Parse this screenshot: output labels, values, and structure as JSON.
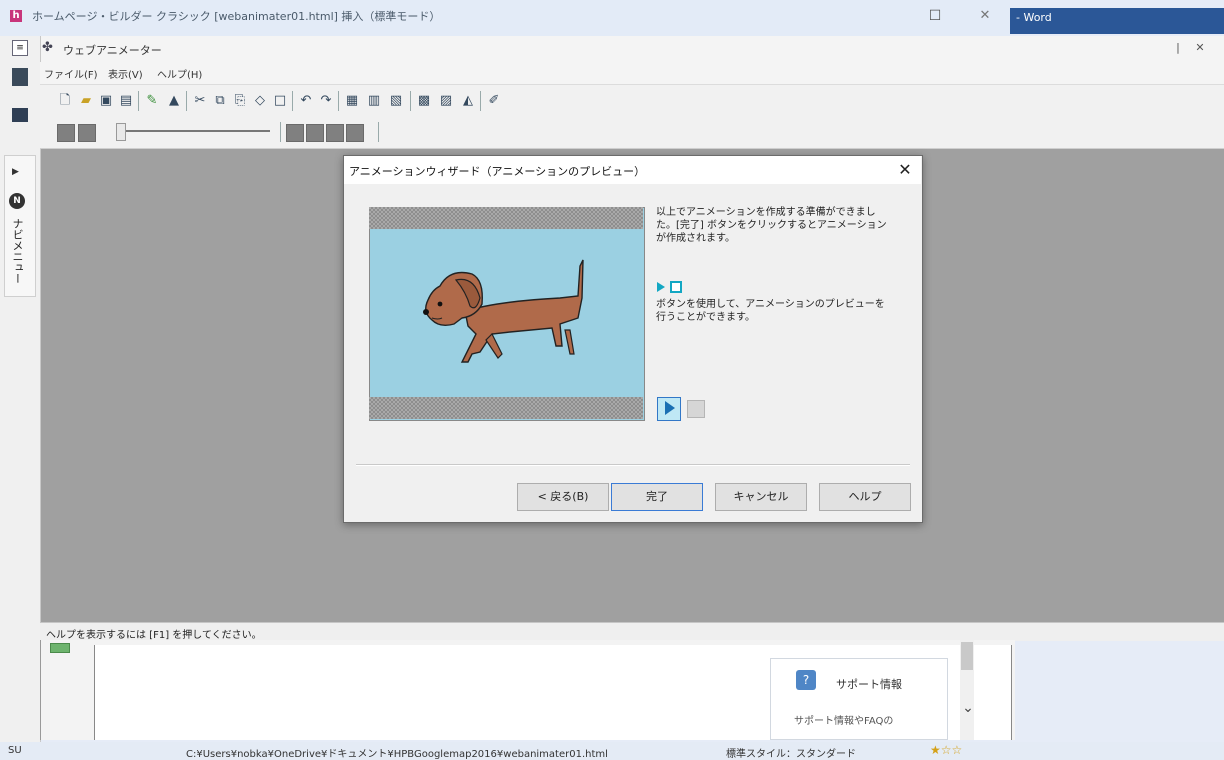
{
  "outer_window": {
    "title": "ホームページ・ビルダー クラシック [webanimater01.html] 挿入（標準モード）",
    "word_label": "- Word"
  },
  "app": {
    "title": "ウェブアニメーター",
    "menu": [
      "ファイル(F)",
      "表示(V)",
      "ヘルプ(H)"
    ]
  },
  "navi": {
    "label": "ナビメニュー"
  },
  "dialog": {
    "title": "アニメーションウィザード（アニメーションのプレビュー）",
    "description_1": "以上でアニメーションを作成する準備ができました。[完了] ボタンをクリックするとアニメーションが作成されます。",
    "description_2": "ボタンを使用して、アニメーションのプレビューを行うことができます。",
    "buttons": {
      "back": "< 戻る(B)",
      "finish": "完了",
      "cancel": "キャンセル",
      "help": "ヘルプ"
    },
    "preview": {
      "background": "#9bd0e2",
      "playing": true
    }
  },
  "status": {
    "help_text": "ヘルプを表示するには [F1] を押してください。"
  },
  "background_app": {
    "support_title": "サポート情報",
    "support_subtitle": "サポート情報やFAQの",
    "status_user": "SU",
    "status_path": "C:¥Users¥nobka¥OneDrive¥ドキュメント¥HPBGooglemap2016¥webanimater01.html",
    "status_style": "標準スタイル：スタンダード"
  },
  "icons": {
    "toolbar_1": [
      "new-file-icon",
      "open-folder-icon",
      "save-icon",
      "save-as-icon",
      "import-icon",
      "export-icon",
      "cut-icon",
      "copy-icon",
      "paste-icon",
      "clear-icon",
      "select-all-icon",
      "undo-icon",
      "redo-icon",
      "properties-icon",
      "frame-icon",
      "frame-settings-icon",
      "wizard-icon",
      "image-icon",
      "effect-icon",
      "draw-icon"
    ],
    "toolbar_2": [
      "first-frame-icon",
      "prev-frame-icon",
      "timeline-slider",
      "play-icon",
      "stop-icon",
      "next-frame-icon",
      "last-frame-icon"
    ]
  },
  "colors": {
    "accent": "#13a7c3",
    "word_blue": "#2b5797",
    "workspace": "#a0a0a0"
  }
}
